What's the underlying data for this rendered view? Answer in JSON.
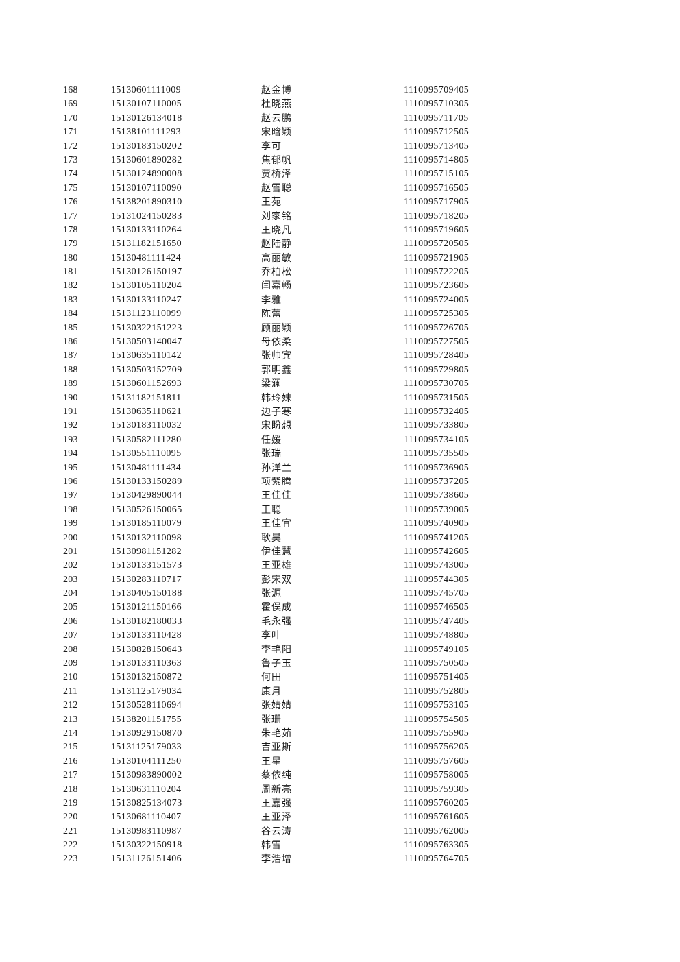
{
  "table": {
    "rows": [
      {
        "idx": "168",
        "exam_no": "15130601111009",
        "name": "赵金博",
        "code": "1110095709405"
      },
      {
        "idx": "169",
        "exam_no": "15130107110005",
        "name": "杜晓燕",
        "code": "1110095710305"
      },
      {
        "idx": "170",
        "exam_no": "15130126134018",
        "name": "赵云鹏",
        "code": "1110095711705"
      },
      {
        "idx": "171",
        "exam_no": "15138101111293",
        "name": "宋晗颖",
        "code": "1110095712505"
      },
      {
        "idx": "172",
        "exam_no": "15130183150202",
        "name": "李可",
        "code": "1110095713405"
      },
      {
        "idx": "173",
        "exam_no": "15130601890282",
        "name": "焦郁帆",
        "code": "1110095714805"
      },
      {
        "idx": "174",
        "exam_no": "15130124890008",
        "name": "贾桥泽",
        "code": "1110095715105"
      },
      {
        "idx": "175",
        "exam_no": "15130107110090",
        "name": "赵雪聪",
        "code": "1110095716505"
      },
      {
        "idx": "176",
        "exam_no": "15138201890310",
        "name": "王苑",
        "code": "1110095717905"
      },
      {
        "idx": "177",
        "exam_no": "15131024150283",
        "name": "刘家铭",
        "code": "1110095718205"
      },
      {
        "idx": "178",
        "exam_no": "15130133110264",
        "name": "王晓凡",
        "code": "1110095719605"
      },
      {
        "idx": "179",
        "exam_no": "15131182151650",
        "name": "赵陆静",
        "code": "1110095720505"
      },
      {
        "idx": "180",
        "exam_no": "15130481111424",
        "name": "高丽敏",
        "code": "1110095721905"
      },
      {
        "idx": "181",
        "exam_no": "15130126150197",
        "name": "乔柏松",
        "code": "1110095722205"
      },
      {
        "idx": "182",
        "exam_no": "15130105110204",
        "name": "闫嘉畅",
        "code": "1110095723605"
      },
      {
        "idx": "183",
        "exam_no": "15130133110247",
        "name": "李雅",
        "code": "1110095724005"
      },
      {
        "idx": "184",
        "exam_no": "15131123110099",
        "name": "陈蕾",
        "code": "1110095725305"
      },
      {
        "idx": "185",
        "exam_no": "15130322151223",
        "name": "顾丽颖",
        "code": "1110095726705"
      },
      {
        "idx": "186",
        "exam_no": "15130503140047",
        "name": "母依柔",
        "code": "1110095727505"
      },
      {
        "idx": "187",
        "exam_no": "15130635110142",
        "name": "张帅宾",
        "code": "1110095728405"
      },
      {
        "idx": "188",
        "exam_no": "15130503152709",
        "name": "郭明鑫",
        "code": "1110095729805"
      },
      {
        "idx": "189",
        "exam_no": "15130601152693",
        "name": "梁澜",
        "code": "1110095730705"
      },
      {
        "idx": "190",
        "exam_no": "15131182151811",
        "name": "韩玲妹",
        "code": "1110095731505"
      },
      {
        "idx": "191",
        "exam_no": "15130635110621",
        "name": "边子寒",
        "code": "1110095732405"
      },
      {
        "idx": "192",
        "exam_no": "15130183110032",
        "name": "宋盼想",
        "code": "1110095733805"
      },
      {
        "idx": "193",
        "exam_no": "15130582111280",
        "name": "任媛",
        "code": "1110095734105"
      },
      {
        "idx": "194",
        "exam_no": "15130551110095",
        "name": "张瑞",
        "code": "1110095735505"
      },
      {
        "idx": "195",
        "exam_no": "15130481111434",
        "name": "孙洋兰",
        "code": "1110095736905"
      },
      {
        "idx": "196",
        "exam_no": "15130133150289",
        "name": "项紫腾",
        "code": "1110095737205"
      },
      {
        "idx": "197",
        "exam_no": "15130429890044",
        "name": "王佳佳",
        "code": "1110095738605"
      },
      {
        "idx": "198",
        "exam_no": "15130526150065",
        "name": "王聪",
        "code": "1110095739005"
      },
      {
        "idx": "199",
        "exam_no": "15130185110079",
        "name": "王佳宜",
        "code": "1110095740905"
      },
      {
        "idx": "200",
        "exam_no": "15130132110098",
        "name": "耿昊",
        "code": "1110095741205"
      },
      {
        "idx": "201",
        "exam_no": "15130981151282",
        "name": "伊佳慧",
        "code": "1110095742605"
      },
      {
        "idx": "202",
        "exam_no": "15130133151573",
        "name": "王亚雄",
        "code": "1110095743005"
      },
      {
        "idx": "203",
        "exam_no": "15130283110717",
        "name": "彭宋双",
        "code": "1110095744305"
      },
      {
        "idx": "204",
        "exam_no": "15130405150188",
        "name": "张源",
        "code": "1110095745705"
      },
      {
        "idx": "205",
        "exam_no": "15130121150166",
        "name": "霍俣成",
        "code": "1110095746505"
      },
      {
        "idx": "206",
        "exam_no": "15130182180033",
        "name": "毛永强",
        "code": "1110095747405"
      },
      {
        "idx": "207",
        "exam_no": "15130133110428",
        "name": "李叶",
        "code": "1110095748805"
      },
      {
        "idx": "208",
        "exam_no": "15130828150643",
        "name": "李艳阳",
        "code": "1110095749105"
      },
      {
        "idx": "209",
        "exam_no": "15130133110363",
        "name": "鲁子玉",
        "code": "1110095750505"
      },
      {
        "idx": "210",
        "exam_no": "15130132150872",
        "name": "何田",
        "code": "1110095751405"
      },
      {
        "idx": "211",
        "exam_no": "15131125179034",
        "name": "康月",
        "code": "1110095752805"
      },
      {
        "idx": "212",
        "exam_no": "15130528110694",
        "name": "张婧婧",
        "code": "1110095753105"
      },
      {
        "idx": "213",
        "exam_no": "15138201151755",
        "name": "张珊",
        "code": "1110095754505"
      },
      {
        "idx": "214",
        "exam_no": "15130929150870",
        "name": "朱艳茹",
        "code": "1110095755905"
      },
      {
        "idx": "215",
        "exam_no": "15131125179033",
        "name": "吉亚斯",
        "code": "1110095756205"
      },
      {
        "idx": "216",
        "exam_no": "15130104111250",
        "name": "王星",
        "code": "1110095757605"
      },
      {
        "idx": "217",
        "exam_no": "15130983890002",
        "name": "蔡依纯",
        "code": "1110095758005"
      },
      {
        "idx": "218",
        "exam_no": "15130631110204",
        "name": "周新亮",
        "code": "1110095759305"
      },
      {
        "idx": "219",
        "exam_no": "15130825134073",
        "name": "王嘉强",
        "code": "1110095760205"
      },
      {
        "idx": "220",
        "exam_no": "15130681110407",
        "name": "王亚泽",
        "code": "1110095761605"
      },
      {
        "idx": "221",
        "exam_no": "15130983110987",
        "name": "谷云涛",
        "code": "1110095762005"
      },
      {
        "idx": "222",
        "exam_no": "15130322150918",
        "name": "韩雪",
        "code": "1110095763305"
      },
      {
        "idx": "223",
        "exam_no": "15131126151406",
        "name": "李浩增",
        "code": "1110095764705"
      }
    ]
  }
}
